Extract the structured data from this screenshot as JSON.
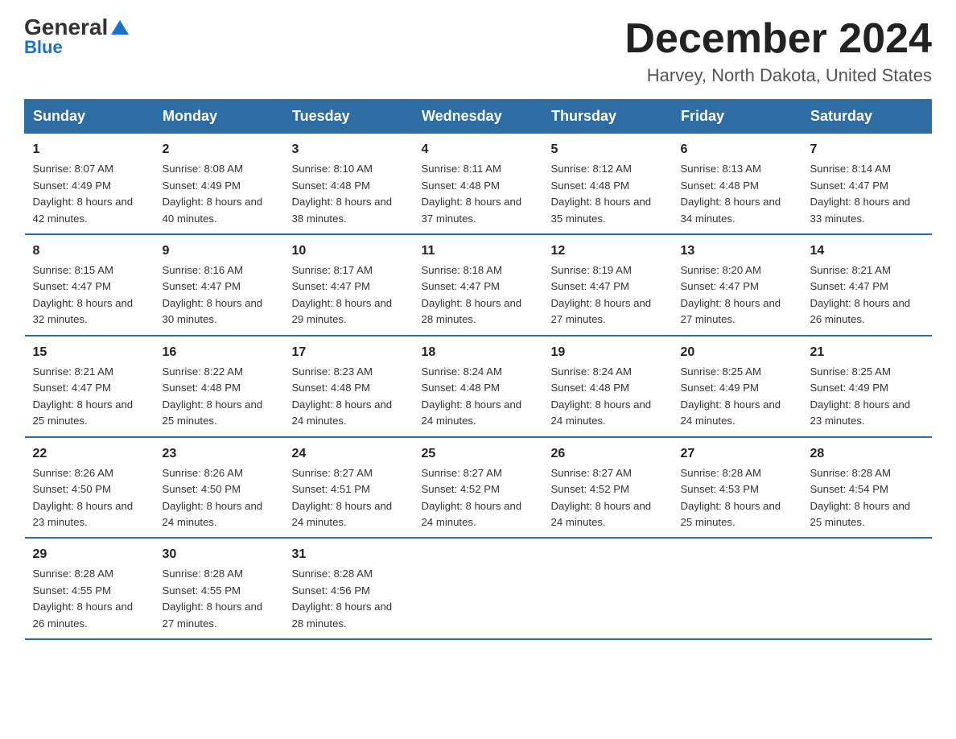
{
  "header": {
    "logo_general": "General",
    "logo_blue": "Blue",
    "main_title": "December 2024",
    "subtitle": "Harvey, North Dakota, United States"
  },
  "days_of_week": [
    "Sunday",
    "Monday",
    "Tuesday",
    "Wednesday",
    "Thursday",
    "Friday",
    "Saturday"
  ],
  "weeks": [
    [
      {
        "day": "1",
        "sunrise": "8:07 AM",
        "sunset": "4:49 PM",
        "daylight": "8 hours and 42 minutes."
      },
      {
        "day": "2",
        "sunrise": "8:08 AM",
        "sunset": "4:49 PM",
        "daylight": "8 hours and 40 minutes."
      },
      {
        "day": "3",
        "sunrise": "8:10 AM",
        "sunset": "4:48 PM",
        "daylight": "8 hours and 38 minutes."
      },
      {
        "day": "4",
        "sunrise": "8:11 AM",
        "sunset": "4:48 PM",
        "daylight": "8 hours and 37 minutes."
      },
      {
        "day": "5",
        "sunrise": "8:12 AM",
        "sunset": "4:48 PM",
        "daylight": "8 hours and 35 minutes."
      },
      {
        "day": "6",
        "sunrise": "8:13 AM",
        "sunset": "4:48 PM",
        "daylight": "8 hours and 34 minutes."
      },
      {
        "day": "7",
        "sunrise": "8:14 AM",
        "sunset": "4:47 PM",
        "daylight": "8 hours and 33 minutes."
      }
    ],
    [
      {
        "day": "8",
        "sunrise": "8:15 AM",
        "sunset": "4:47 PM",
        "daylight": "8 hours and 32 minutes."
      },
      {
        "day": "9",
        "sunrise": "8:16 AM",
        "sunset": "4:47 PM",
        "daylight": "8 hours and 30 minutes."
      },
      {
        "day": "10",
        "sunrise": "8:17 AM",
        "sunset": "4:47 PM",
        "daylight": "8 hours and 29 minutes."
      },
      {
        "day": "11",
        "sunrise": "8:18 AM",
        "sunset": "4:47 PM",
        "daylight": "8 hours and 28 minutes."
      },
      {
        "day": "12",
        "sunrise": "8:19 AM",
        "sunset": "4:47 PM",
        "daylight": "8 hours and 27 minutes."
      },
      {
        "day": "13",
        "sunrise": "8:20 AM",
        "sunset": "4:47 PM",
        "daylight": "8 hours and 27 minutes."
      },
      {
        "day": "14",
        "sunrise": "8:21 AM",
        "sunset": "4:47 PM",
        "daylight": "8 hours and 26 minutes."
      }
    ],
    [
      {
        "day": "15",
        "sunrise": "8:21 AM",
        "sunset": "4:47 PM",
        "daylight": "8 hours and 25 minutes."
      },
      {
        "day": "16",
        "sunrise": "8:22 AM",
        "sunset": "4:48 PM",
        "daylight": "8 hours and 25 minutes."
      },
      {
        "day": "17",
        "sunrise": "8:23 AM",
        "sunset": "4:48 PM",
        "daylight": "8 hours and 24 minutes."
      },
      {
        "day": "18",
        "sunrise": "8:24 AM",
        "sunset": "4:48 PM",
        "daylight": "8 hours and 24 minutes."
      },
      {
        "day": "19",
        "sunrise": "8:24 AM",
        "sunset": "4:48 PM",
        "daylight": "8 hours and 24 minutes."
      },
      {
        "day": "20",
        "sunrise": "8:25 AM",
        "sunset": "4:49 PM",
        "daylight": "8 hours and 24 minutes."
      },
      {
        "day": "21",
        "sunrise": "8:25 AM",
        "sunset": "4:49 PM",
        "daylight": "8 hours and 23 minutes."
      }
    ],
    [
      {
        "day": "22",
        "sunrise": "8:26 AM",
        "sunset": "4:50 PM",
        "daylight": "8 hours and 23 minutes."
      },
      {
        "day": "23",
        "sunrise": "8:26 AM",
        "sunset": "4:50 PM",
        "daylight": "8 hours and 24 minutes."
      },
      {
        "day": "24",
        "sunrise": "8:27 AM",
        "sunset": "4:51 PM",
        "daylight": "8 hours and 24 minutes."
      },
      {
        "day": "25",
        "sunrise": "8:27 AM",
        "sunset": "4:52 PM",
        "daylight": "8 hours and 24 minutes."
      },
      {
        "day": "26",
        "sunrise": "8:27 AM",
        "sunset": "4:52 PM",
        "daylight": "8 hours and 24 minutes."
      },
      {
        "day": "27",
        "sunrise": "8:28 AM",
        "sunset": "4:53 PM",
        "daylight": "8 hours and 25 minutes."
      },
      {
        "day": "28",
        "sunrise": "8:28 AM",
        "sunset": "4:54 PM",
        "daylight": "8 hours and 25 minutes."
      }
    ],
    [
      {
        "day": "29",
        "sunrise": "8:28 AM",
        "sunset": "4:55 PM",
        "daylight": "8 hours and 26 minutes."
      },
      {
        "day": "30",
        "sunrise": "8:28 AM",
        "sunset": "4:55 PM",
        "daylight": "8 hours and 27 minutes."
      },
      {
        "day": "31",
        "sunrise": "8:28 AM",
        "sunset": "4:56 PM",
        "daylight": "8 hours and 28 minutes."
      },
      {
        "day": "",
        "sunrise": "",
        "sunset": "",
        "daylight": ""
      },
      {
        "day": "",
        "sunrise": "",
        "sunset": "",
        "daylight": ""
      },
      {
        "day": "",
        "sunrise": "",
        "sunset": "",
        "daylight": ""
      },
      {
        "day": "",
        "sunrise": "",
        "sunset": "",
        "daylight": ""
      }
    ]
  ]
}
